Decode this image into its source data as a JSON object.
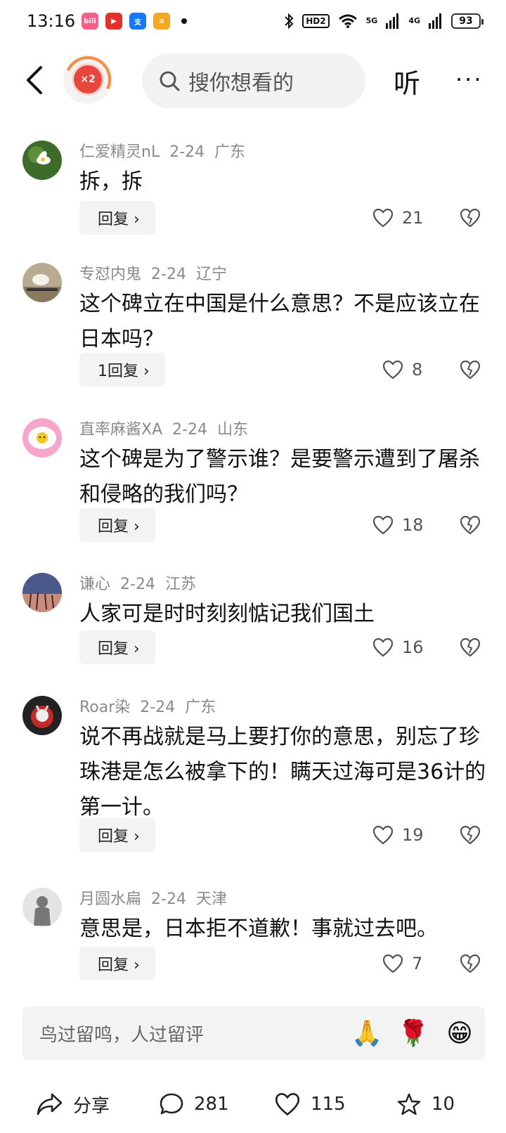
{
  "status_bar": {
    "time": "13:16",
    "hd_label": "HD2",
    "net1": "5G",
    "net2": "4G",
    "battery": "93",
    "apps": [
      {
        "name": "bilibili-app-icon",
        "color": "#ff5c8a",
        "label": "bili"
      },
      {
        "name": "video-app-icon",
        "color": "#e8302a",
        "label": "▶"
      },
      {
        "name": "alipay-app-icon",
        "color": "#1677ff",
        "label": "支"
      },
      {
        "name": "wallet-app-icon",
        "color": "#f5a623",
        "label": "≡"
      }
    ]
  },
  "top_nav": {
    "badge_label": "×2",
    "search_placeholder": "搜你想看的",
    "listen_label": "听",
    "more_label": "···"
  },
  "comments": [
    {
      "user": "仁爱精灵nL",
      "date": "2-24",
      "location": "广东",
      "text": "拆，拆",
      "reply_label": "回复 ›",
      "likes": "21"
    },
    {
      "user": "专怼内鬼",
      "date": "2-24",
      "location": "辽宁",
      "text": "这个碑立在中国是什么意思？不是应该立在日本吗？",
      "reply_label": "1回复 ›",
      "likes": "8"
    },
    {
      "user": "直率麻酱XA",
      "date": "2-24",
      "location": "山东",
      "text": "这个碑是为了警示谁？是要警示遭到了屠杀和侵略的我们吗？",
      "reply_label": "回复 ›",
      "likes": "18"
    },
    {
      "user": "谦心",
      "date": "2-24",
      "location": "江苏",
      "text": "人家可是时时刻刻惦记我们国土",
      "reply_label": "回复 ›",
      "likes": "16"
    },
    {
      "user": "Roar染",
      "date": "2-24",
      "location": "广东",
      "text": "说不再战就是马上要打你的意思，别忘了珍珠港是怎么被拿下的！瞒天过海可是36计的第一计。",
      "reply_label": "回复 ›",
      "likes": "19"
    },
    {
      "user": "月圆水扁",
      "date": "2-24",
      "location": "天津",
      "text": "意思是，日本拒不道歉！事就过去吧。",
      "reply_label": "回复 ›",
      "likes": "7"
    }
  ],
  "input_bar": {
    "placeholder": "鸟过留鸣，人过留评",
    "emojis": [
      "🙏",
      "🌹",
      "😁"
    ]
  },
  "bottom_bar": {
    "share_label": "分享",
    "comment_count": "281",
    "like_count": "115",
    "star_count": "10"
  }
}
